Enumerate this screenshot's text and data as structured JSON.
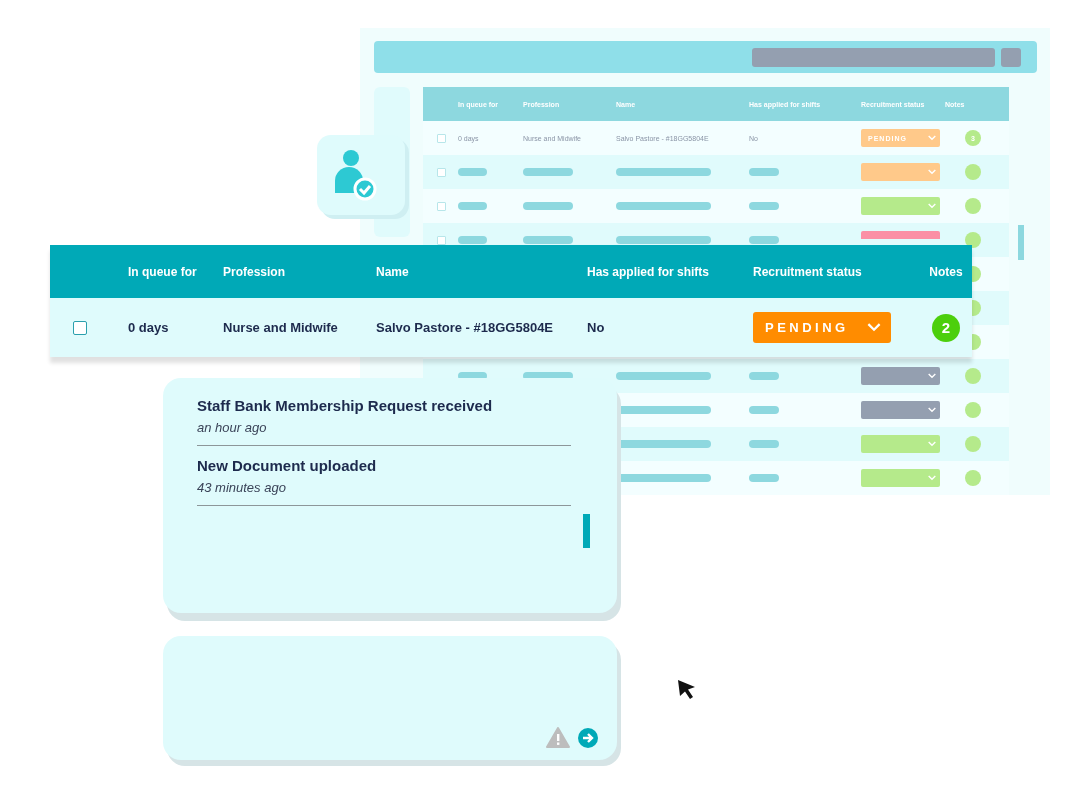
{
  "background_window": {
    "columns": [
      "In queue for",
      "Profession",
      "Name",
      "Has applied for shifts",
      "Recruitment status",
      "Notes"
    ],
    "rows": [
      {
        "kind": "text",
        "checked": false,
        "in_queue_for": "0 days",
        "profession": "Nurse and Midwife",
        "name": "Salvo Pastore - #18GG5804E",
        "has_applied": "No",
        "status": "PENDING",
        "color": "#ffc98a",
        "notes": "3"
      },
      {
        "kind": "skeleton",
        "checked": false,
        "color": "#ffc98a"
      },
      {
        "kind": "skeleton",
        "checked": false,
        "color": "#b5ea8b"
      },
      {
        "kind": "skeleton",
        "checked": false,
        "color": "#fb8fa5"
      },
      {
        "kind": "dot_only"
      },
      {
        "kind": "skeleton"
      },
      {
        "kind": "skeleton"
      },
      {
        "kind": "skeleton",
        "color": "#949fb0"
      },
      {
        "kind": "skeleton",
        "color": "#949fb0"
      },
      {
        "kind": "skeleton",
        "color": "#b5ea8b"
      },
      {
        "kind": "skeleton",
        "color": "#b5ea8b"
      }
    ]
  },
  "featured_table": {
    "columns": [
      "In queue for",
      "Profession",
      "Name",
      "Has applied for shifts",
      "Recruitment status",
      "Notes"
    ],
    "row": {
      "checked": false,
      "in_queue_for": "0 days",
      "profession": "Nurse and Midwife",
      "name": "Salvo Pastore - #18GG5804E",
      "has_applied": "No",
      "status": "PENDING",
      "color": "#ff8c00",
      "notes": "2"
    }
  },
  "notifications": {
    "items": [
      {
        "title": "Staff Bank Membership Request received",
        "time": "an hour ago"
      },
      {
        "title": "New Document uploaded",
        "time": "43 minutes ago"
      }
    ]
  }
}
